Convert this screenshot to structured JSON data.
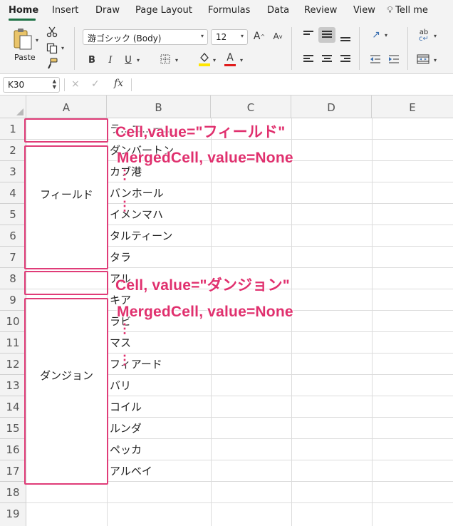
{
  "ribbon": {
    "tabs": [
      "Home",
      "Insert",
      "Draw",
      "Page Layout",
      "Formulas",
      "Data",
      "Review",
      "View",
      "Tell me"
    ],
    "paste_label": "Paste",
    "font_name": "游ゴシック (Body)",
    "font_size": "12",
    "bold": "B",
    "italic": "I",
    "underline": "U",
    "font_color_letter": "A",
    "highlight_color": "#ffe600",
    "font_color": "#e01b1b",
    "accent_color": "#1e7145"
  },
  "formula_bar": {
    "name_box": "K30",
    "cancel_icon": "×",
    "enter_icon": "✓",
    "fx_label": "fx",
    "formula": ""
  },
  "columns": [
    "A",
    "B",
    "C",
    "D",
    "E"
  ],
  "rows": [
    "1",
    "2",
    "3",
    "4",
    "5",
    "6",
    "7",
    "8",
    "9",
    "10",
    "11",
    "12",
    "13",
    "14",
    "15",
    "16",
    "17",
    "18",
    "19"
  ],
  "merged": {
    "field_label": "フィールド",
    "dungeon_label": "ダンジョン"
  },
  "column_b": [
    {
      "row": 1,
      "text": "ラ…ニ…ー…"
    },
    {
      "row": 2,
      "text": "ダンバートン"
    },
    {
      "row": 3,
      "text": "カブ港"
    },
    {
      "row": 4,
      "text": "バンホール"
    },
    {
      "row": 5,
      "text": "イメンマハ"
    },
    {
      "row": 6,
      "text": "タルティーン"
    },
    {
      "row": 7,
      "text": "タラ"
    },
    {
      "row": 8,
      "text": "アル"
    },
    {
      "row": 9,
      "text": "キア"
    },
    {
      "row": 10,
      "text": "ラビ"
    },
    {
      "row": 11,
      "text": "マス"
    },
    {
      "row": 12,
      "text": "フィアード"
    },
    {
      "row": 13,
      "text": "バリ"
    },
    {
      "row": 14,
      "text": "コイル"
    },
    {
      "row": 15,
      "text": "ルンダ"
    },
    {
      "row": 16,
      "text": "ペッカ"
    },
    {
      "row": 17,
      "text": "アルベイ"
    }
  ],
  "annotations": {
    "cell_field": "Cell,value=\"フィールド\"",
    "merged_1": "MergedCell, value=None",
    "cell_dungeon": "Cell, value=\"ダンジョン\"",
    "merged_2": "MergedCell, value=None",
    "dots": "⋮",
    "color": "#e03c78"
  }
}
